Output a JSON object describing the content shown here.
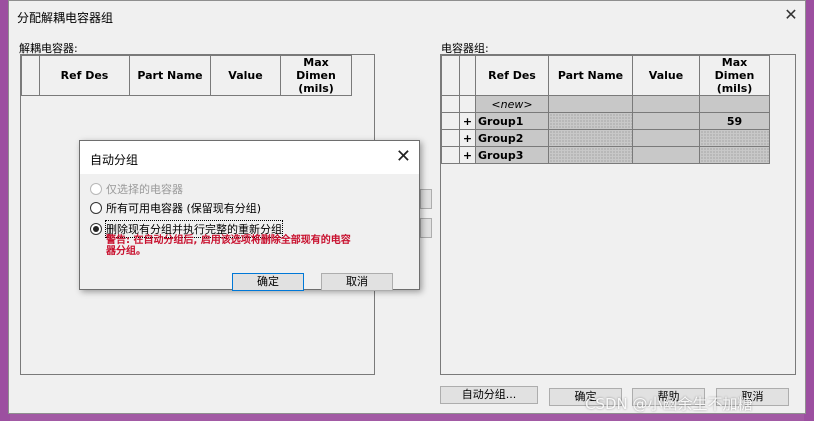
{
  "main_dialog": {
    "title": "分配解耦电容器组",
    "close_glyph": "✕"
  },
  "left_panel": {
    "label": "解耦电容器:",
    "columns": [
      "",
      "Ref Des",
      "Part Name",
      "Value",
      "Max Dimen\n(mils)"
    ]
  },
  "right_panel": {
    "label": "电容器组:",
    "columns": [
      "",
      "",
      "Ref Des",
      "Part Name",
      "Value",
      "Max Dimen\n(mils)"
    ],
    "rows": [
      {
        "expander": "",
        "ref_des": "<new>",
        "part_name": "",
        "value": "",
        "max_dimen": ""
      },
      {
        "expander": "+",
        "ref_des": "Group1",
        "part_name": "",
        "value": "",
        "max_dimen": "59"
      },
      {
        "expander": "+",
        "ref_des": "Group2",
        "part_name": "",
        "value": "",
        "max_dimen": ""
      },
      {
        "expander": "+",
        "ref_des": "Group3",
        "part_name": "",
        "value": "",
        "max_dimen": ""
      }
    ]
  },
  "buttons": {
    "auto_group": "自动分组...",
    "ok": "确定",
    "help": "帮助",
    "cancel": "取消"
  },
  "auto_group_dialog": {
    "title": "自动分组",
    "close_glyph": "✕",
    "options": [
      {
        "label": "仅选择的电容器",
        "checked": false,
        "disabled": true
      },
      {
        "label": "所有可用电容器 (保留现有分组)",
        "checked": false,
        "disabled": false
      },
      {
        "label": "删除现有分组并执行完整的重新分组",
        "checked": true,
        "disabled": false
      }
    ],
    "warning": "警告: 在自动分组后, 启用该选项将删除全部现有的电容器分组。",
    "ok": "确定",
    "cancel": "取消"
  },
  "watermark": "CSDN @小幽余生不加糖"
}
